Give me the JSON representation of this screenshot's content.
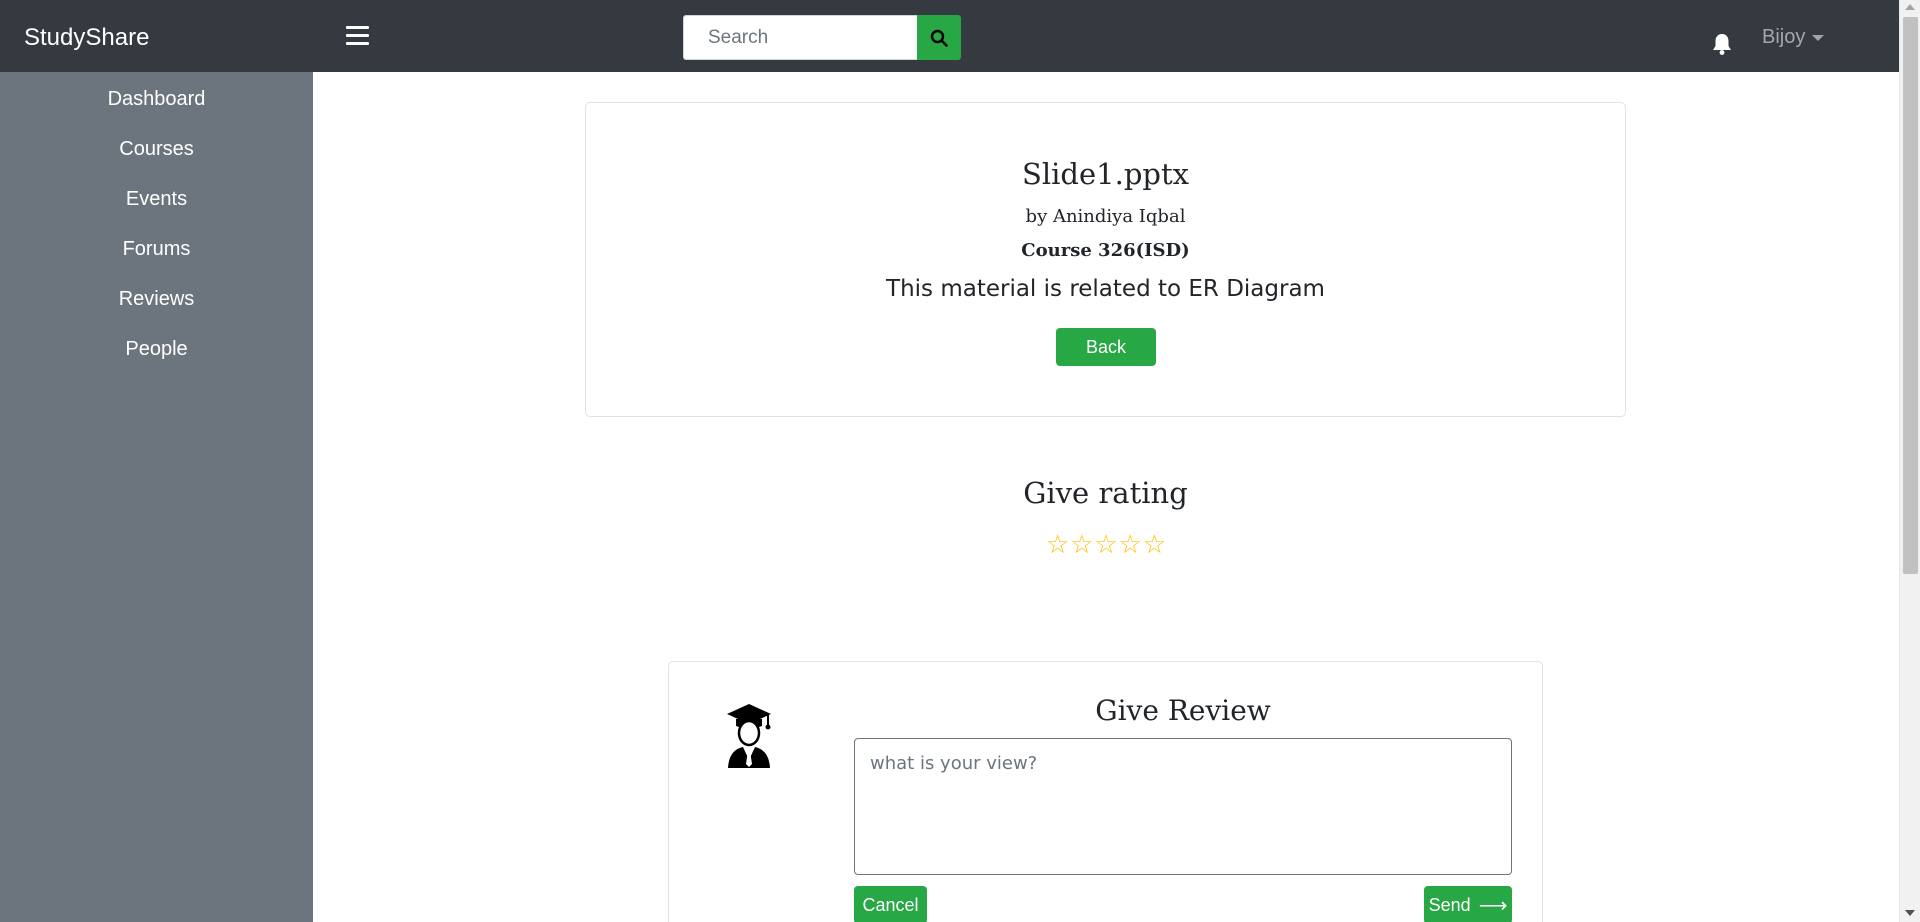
{
  "navbar": {
    "brand": "StudyShare",
    "search_placeholder": "Search",
    "user_name": "Bijoy"
  },
  "sidebar": {
    "items": [
      {
        "label": "Dashboard"
      },
      {
        "label": "Courses"
      },
      {
        "label": "Events"
      },
      {
        "label": "Forums"
      },
      {
        "label": "Reviews"
      },
      {
        "label": "People"
      }
    ]
  },
  "material": {
    "title": "Slide1.pptx",
    "author": "by Anindiya Iqbal",
    "course": "Course 326(ISD)",
    "description": "This material is related to ER Diagram",
    "back_label": "Back"
  },
  "rating": {
    "title": "Give rating",
    "stars_filled": 0,
    "stars_total": 5
  },
  "review": {
    "title": "Give Review",
    "placeholder": "what is your view?",
    "value": "",
    "cancel_label": "Cancel",
    "send_label": "Send"
  },
  "colors": {
    "navbar": "#343a40",
    "sidebar": "#6c757d",
    "accent": "#28a745",
    "star": "#ffc107"
  },
  "icons": {
    "menu": "hamburger-menu-icon",
    "search": "search-icon",
    "notifications": "bell-icon",
    "avatar": "graduate-avatar-icon",
    "send": "arrow-right-icon"
  }
}
